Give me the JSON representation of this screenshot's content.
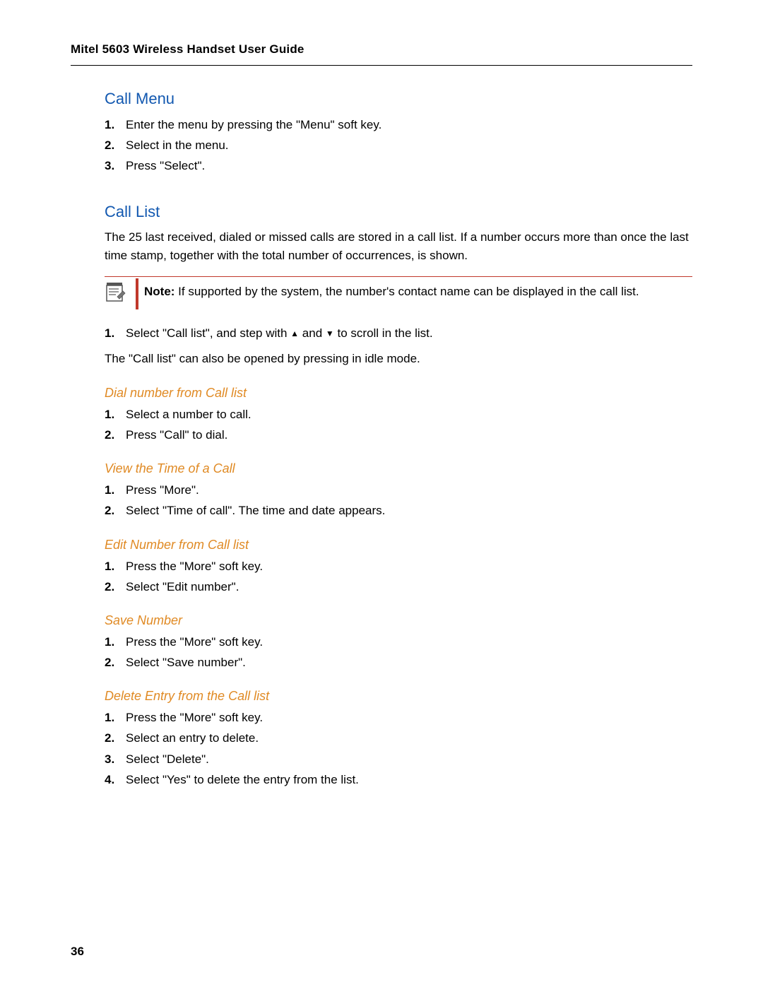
{
  "header": "Mitel 5603 Wireless Handset User Guide",
  "pagenum": "36",
  "s1": {
    "title": "Call Menu",
    "steps": [
      "Enter the menu by pressing the \"Menu\" soft key.",
      "Select        in the menu.",
      "Press \"Select\"."
    ]
  },
  "s2": {
    "title": "Call List",
    "intro": "The 25 last received, dialed or missed calls are stored in a call list. If a number occurs more than once the last time stamp, together with the total number of occurrences, is shown.",
    "note_label": "Note:",
    "note_text": " If supported by the system, the number's contact name can be displayed in the call list.",
    "step1_a": "Select \"Call list\", and step with ",
    "step1_mid": " and ",
    "step1_b": " to scroll in the list.",
    "after": "The \"Call list\" can also be opened by pressing        in idle mode."
  },
  "s3": {
    "title": "Dial number from Call list",
    "steps": [
      "Select a number to call.",
      "Press \"Call\" to dial."
    ]
  },
  "s4": {
    "title": "View the Time of a Call",
    "steps": [
      "Press \"More\".",
      "Select \"Time of call\". The time and date appears."
    ]
  },
  "s5": {
    "title": "Edit Number from Call list",
    "steps": [
      "Press the \"More\" soft key.",
      "Select \"Edit number\"."
    ]
  },
  "s6": {
    "title": "Save Number",
    "steps": [
      "Press the \"More\" soft key.",
      "Select \"Save number\"."
    ]
  },
  "s7": {
    "title": "Delete Entry from the Call list",
    "steps": [
      "Press the \"More\" soft key.",
      "Select an entry to delete.",
      "Select \"Delete\".",
      "Select \"Yes\" to delete the entry from the list."
    ]
  }
}
